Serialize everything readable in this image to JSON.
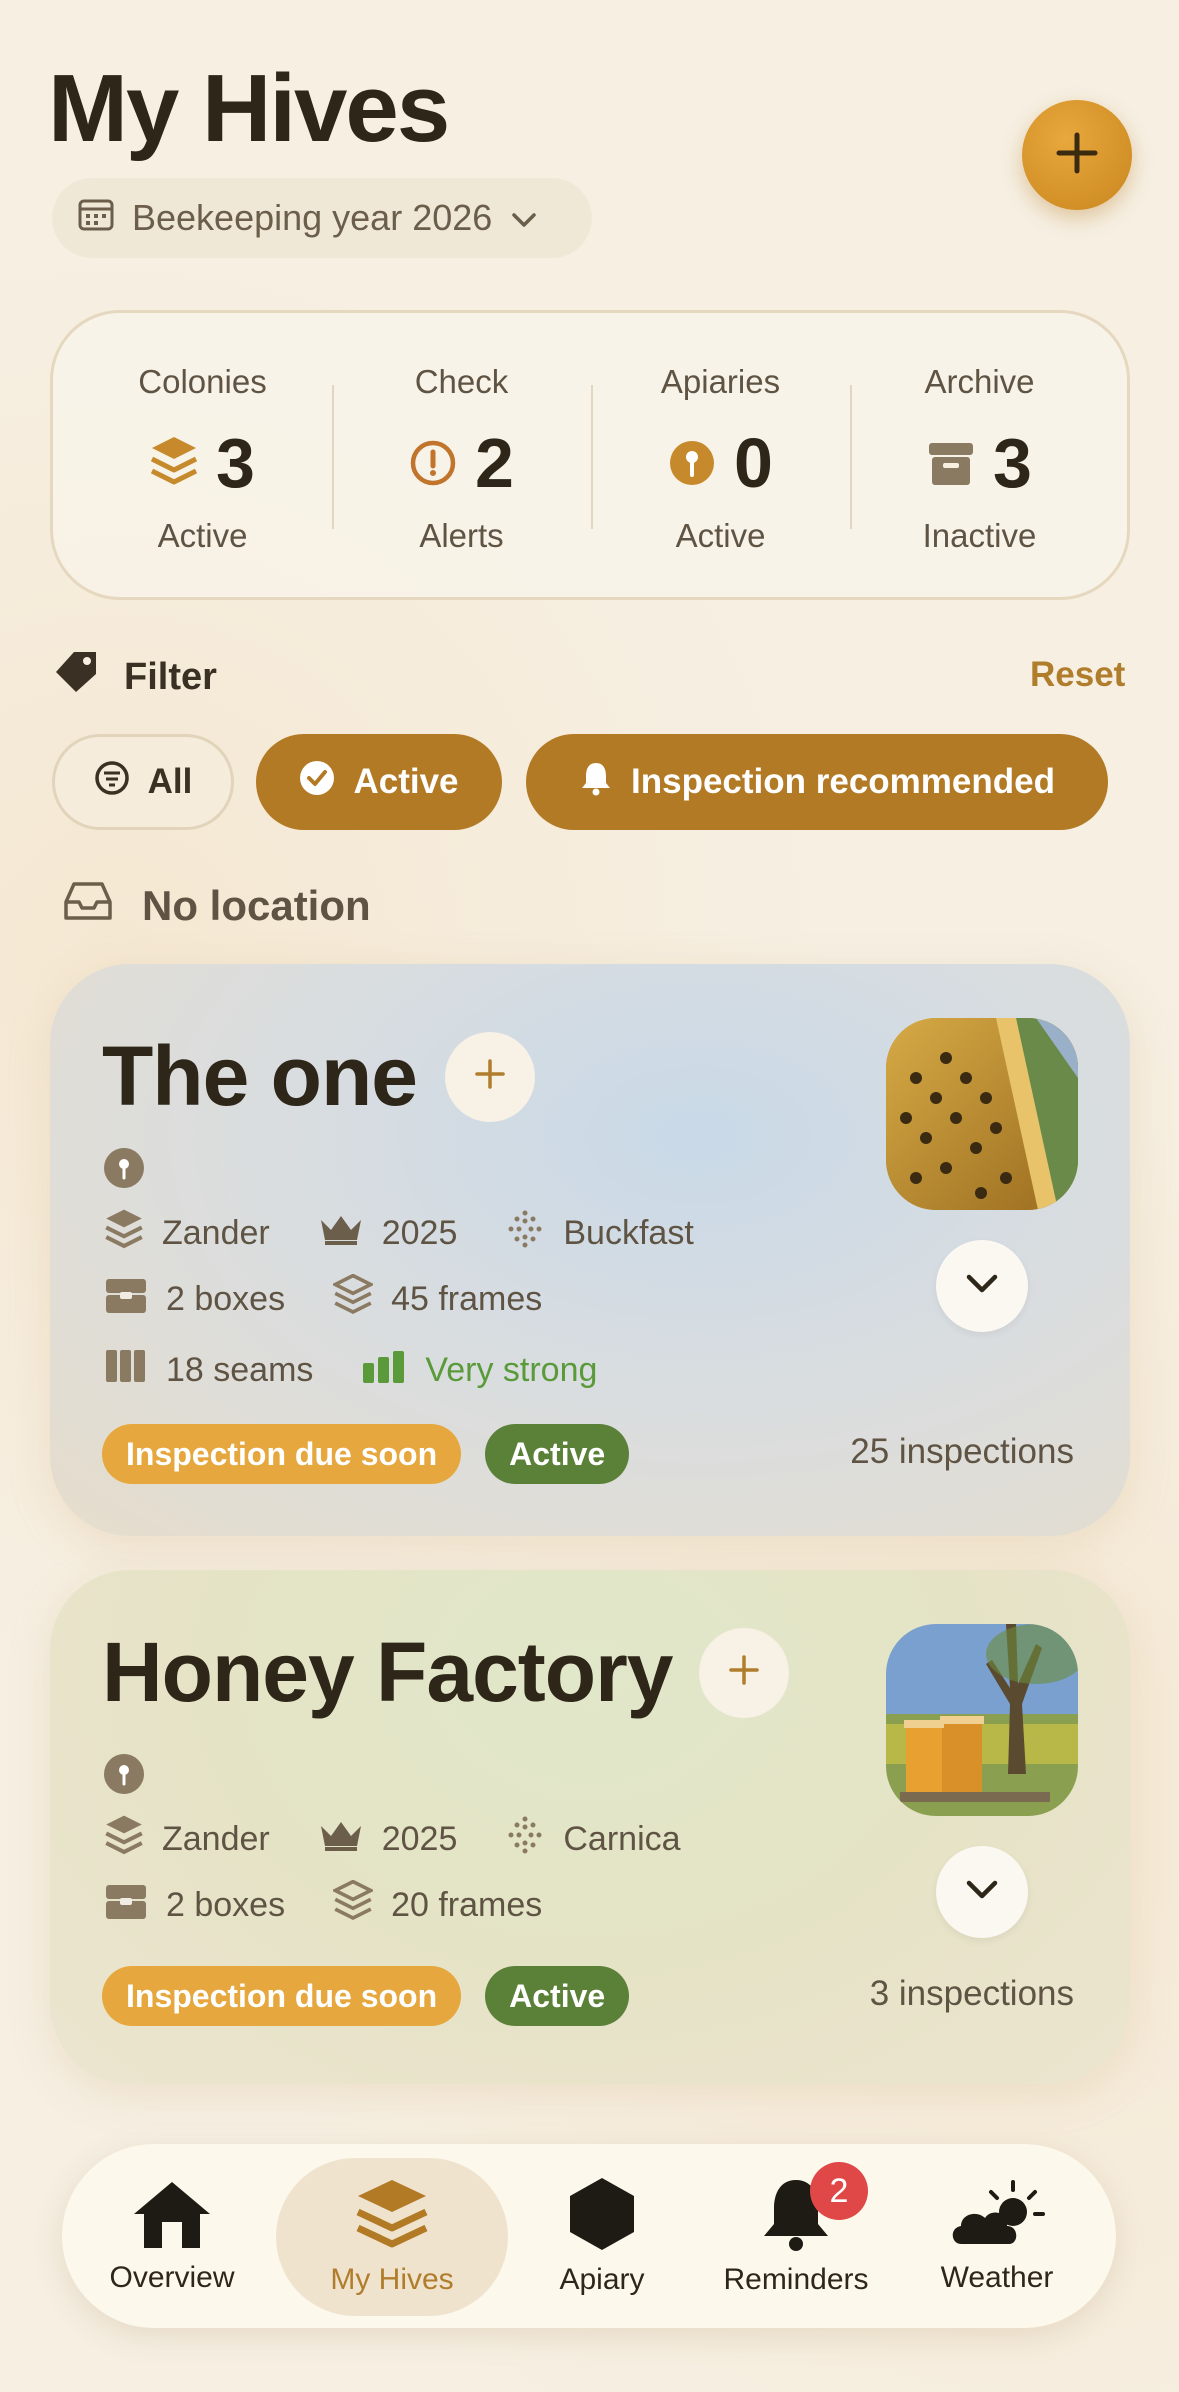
{
  "header": {
    "title": "My Hives",
    "year_selector": "Beekeeping year 2026",
    "add_button_icon": "plus-icon"
  },
  "stats": [
    {
      "label": "Colonies",
      "value": "3",
      "sub": "Active",
      "icon": "layers-icon"
    },
    {
      "label": "Check",
      "value": "2",
      "sub": "Alerts",
      "icon": "alert-circle-icon"
    },
    {
      "label": "Apiaries",
      "value": "0",
      "sub": "Active",
      "icon": "pin-icon"
    },
    {
      "label": "Archive",
      "value": "3",
      "sub": "Inactive",
      "icon": "archive-icon"
    }
  ],
  "filter": {
    "title": "Filter",
    "reset": "Reset",
    "chips": [
      {
        "label": "All",
        "selected": false
      },
      {
        "label": "Active",
        "selected": true
      },
      {
        "label": "Inspection recommended",
        "selected": true
      }
    ]
  },
  "location": {
    "label": "No location"
  },
  "hives": [
    {
      "name": "The one",
      "beekeeper": "Zander",
      "queen_year": "2025",
      "breed": "Buckfast",
      "boxes": "2 boxes",
      "frames": "45 frames",
      "seams": "18 seams",
      "strength": "Very strong",
      "badge_due": "Inspection due soon",
      "badge_status": "Active",
      "inspections": "25 inspections"
    },
    {
      "name": "Honey Factory",
      "beekeeper": "Zander",
      "queen_year": "2025",
      "breed": "Carnica",
      "boxes": "2 boxes",
      "frames": "20 frames",
      "badge_due": "Inspection due soon",
      "badge_status": "Active",
      "inspections": "3 inspections"
    }
  ],
  "nav": {
    "items": [
      {
        "label": "Overview",
        "icon": "home-icon"
      },
      {
        "label": "My Hives",
        "icon": "hive-layers-icon",
        "active": true
      },
      {
        "label": "Apiary",
        "icon": "hexagon-icon"
      },
      {
        "label": "Reminders",
        "icon": "bell-icon",
        "badge": "2"
      },
      {
        "label": "Weather",
        "icon": "weather-icon"
      }
    ]
  },
  "colors": {
    "accent": "#b37a25",
    "accent_light": "#e6a83e",
    "active_green": "#5b8139",
    "strength_green": "#5a9a3a",
    "alert_red": "#e04848"
  }
}
